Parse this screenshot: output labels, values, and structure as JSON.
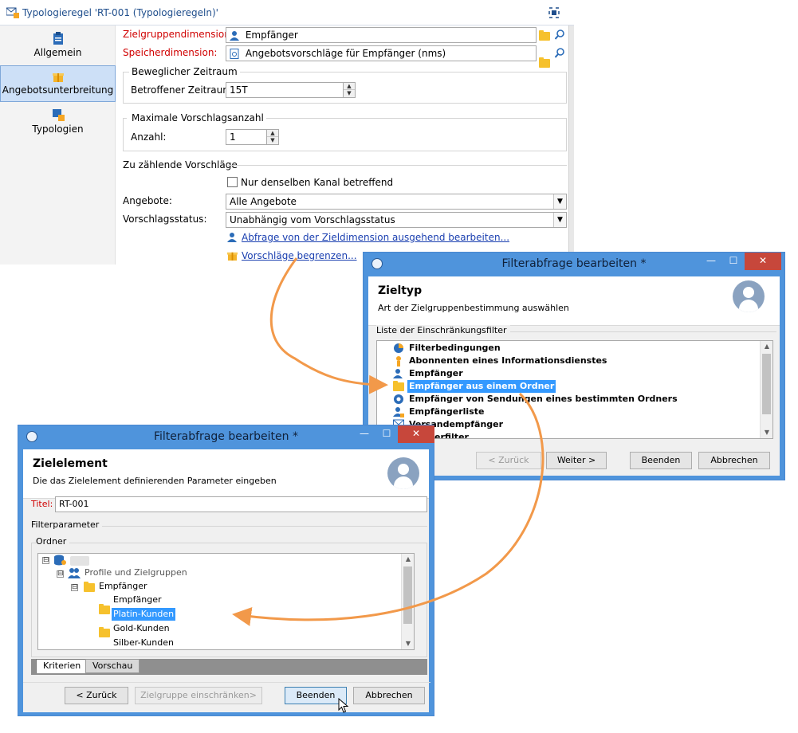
{
  "main_window": {
    "title": "Typologieregel 'RT-001 (Typologieregeln)'",
    "nav": [
      {
        "label": "Allgemein",
        "icon": "clipboard-icon"
      },
      {
        "label": "Angebotsunterbreitung",
        "icon": "gift-icon",
        "active": true
      },
      {
        "label": "Typologien",
        "icon": "typology-icon"
      }
    ],
    "target_dimension": {
      "label": "Zielgruppendimension:",
      "value": "Empfänger"
    },
    "storage_dimension": {
      "label": "Speicherdimension:",
      "value": "Angebotsvorschläge für Empfänger (nms)"
    },
    "moving_period": {
      "group": "Beweglicher Zeitraum",
      "label": "Betroffener Zeitraum:",
      "value": "15T"
    },
    "max_proposals": {
      "group": "Maximale Vorschlagsanzahl",
      "label": "Anzahl:",
      "value": "1"
    },
    "proposals_to_count": {
      "group": "Zu zählende Vorschläge",
      "same_channel_label": "Nur denselben Kanal betreffend",
      "offers_label": "Angebote:",
      "offers_value": "Alle Angebote",
      "status_label": "Vorschlagsstatus:",
      "status_value": "Unabhängig vom Vorschlagsstatus",
      "link_edit_query": "Abfrage von der Zieldimension ausgehend bearbeiten...",
      "link_limit": "Vorschläge begrenzen..."
    }
  },
  "dialog_target_type": {
    "title": "Filterabfrage bearbeiten *",
    "header_title": "Zieltyp",
    "header_subtitle": "Art der Zielgruppenbestimmung auswählen",
    "list_label": "Liste der Einschränkungsfilter",
    "items": [
      {
        "label": "Filterbedingungen",
        "icon": "filter-conditions-icon"
      },
      {
        "label": "Abonnenten eines Informationsdienstes",
        "icon": "subscription-icon"
      },
      {
        "label": "Empfänger",
        "icon": "person-icon"
      },
      {
        "label": "Empfänger aus einem Ordner",
        "icon": "folder-person-icon",
        "selected": true
      },
      {
        "label": "Empfänger von Sendungen eines bestimmten Ordners",
        "icon": "delivery-gear-icon"
      },
      {
        "label": "Empfängerliste",
        "icon": "recipient-list-icon"
      },
      {
        "label": "Versandempfänger",
        "icon": "envelope-icon"
      },
      {
        "label": "erfilter",
        "icon": "filter-icon"
      }
    ],
    "buttons": {
      "back": "< Zurück",
      "next": "Weiter >",
      "finish": "Beenden",
      "cancel": "Abbrechen"
    },
    "window_controls": {
      "minimize": "—",
      "maximize": "☐",
      "close": "✕"
    }
  },
  "dialog_target_element": {
    "title": "Filterabfrage bearbeiten *",
    "header_title": "Zielelement",
    "header_subtitle": "Die das Zielelement definierenden Parameter eingeben",
    "title_label": "Titel:",
    "title_value": "RT-001",
    "filter_params_label": "Filterparameter",
    "folder_label": "Ordner",
    "tree": [
      {
        "label": "",
        "icon": "database-icon",
        "level": 0,
        "expander": "⊟"
      },
      {
        "label": "Profile und Zielgruppen",
        "icon": "profiles-icon",
        "level": 1,
        "expander": "⊟"
      },
      {
        "label": "Empfänger",
        "icon": "folder-person-icon",
        "level": 2,
        "expander": "⊟"
      },
      {
        "label": "Empfänger",
        "icon": "folder-person-icon",
        "level": 3
      },
      {
        "label": "Platin-Kunden",
        "icon": "folder-person-icon",
        "level": 3,
        "selected": true
      },
      {
        "label": "Gold-Kunden",
        "icon": "folder-person-icon",
        "level": 3
      },
      {
        "label": "Silber-Kunden",
        "icon": "folder-person-icon",
        "level": 3
      }
    ],
    "tabs": [
      "Kriterien",
      "Vorschau"
    ],
    "buttons": {
      "back": "< Zurück",
      "restrict": "Zielgruppe einschränken>",
      "finish": "Beenden",
      "cancel": "Abbrechen"
    },
    "window_controls": {
      "minimize": "—",
      "maximize": "☐",
      "close": "✕"
    }
  },
  "colors": {
    "accent": "#4f94dc",
    "selection": "#3399ff",
    "arrow": "#f2994a",
    "required": "#d00000"
  }
}
